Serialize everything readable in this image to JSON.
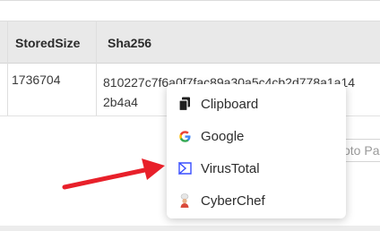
{
  "table": {
    "headers": {
      "stored_size": "StoredSize",
      "sha256": "Sha256"
    },
    "row": {
      "stored_size": "1736704",
      "sha256_line1": "810227c7f6a0f7fac89a30a5c4cb2d778a1a14",
      "sha256_line2": "2b4a4"
    }
  },
  "goto_input": {
    "placeholder": "oto Pa"
  },
  "context_menu": {
    "items": [
      {
        "label": "Clipboard",
        "icon": "clipboard-icon"
      },
      {
        "label": "Google",
        "icon": "google-icon"
      },
      {
        "label": "VirusTotal",
        "icon": "virustotal-icon"
      },
      {
        "label": "CyberChef",
        "icon": "cyberchef-icon"
      }
    ]
  },
  "colors": {
    "arrow": "#e8202a",
    "header_bg": "#e9e9e9",
    "virustotal": "#394eff"
  }
}
